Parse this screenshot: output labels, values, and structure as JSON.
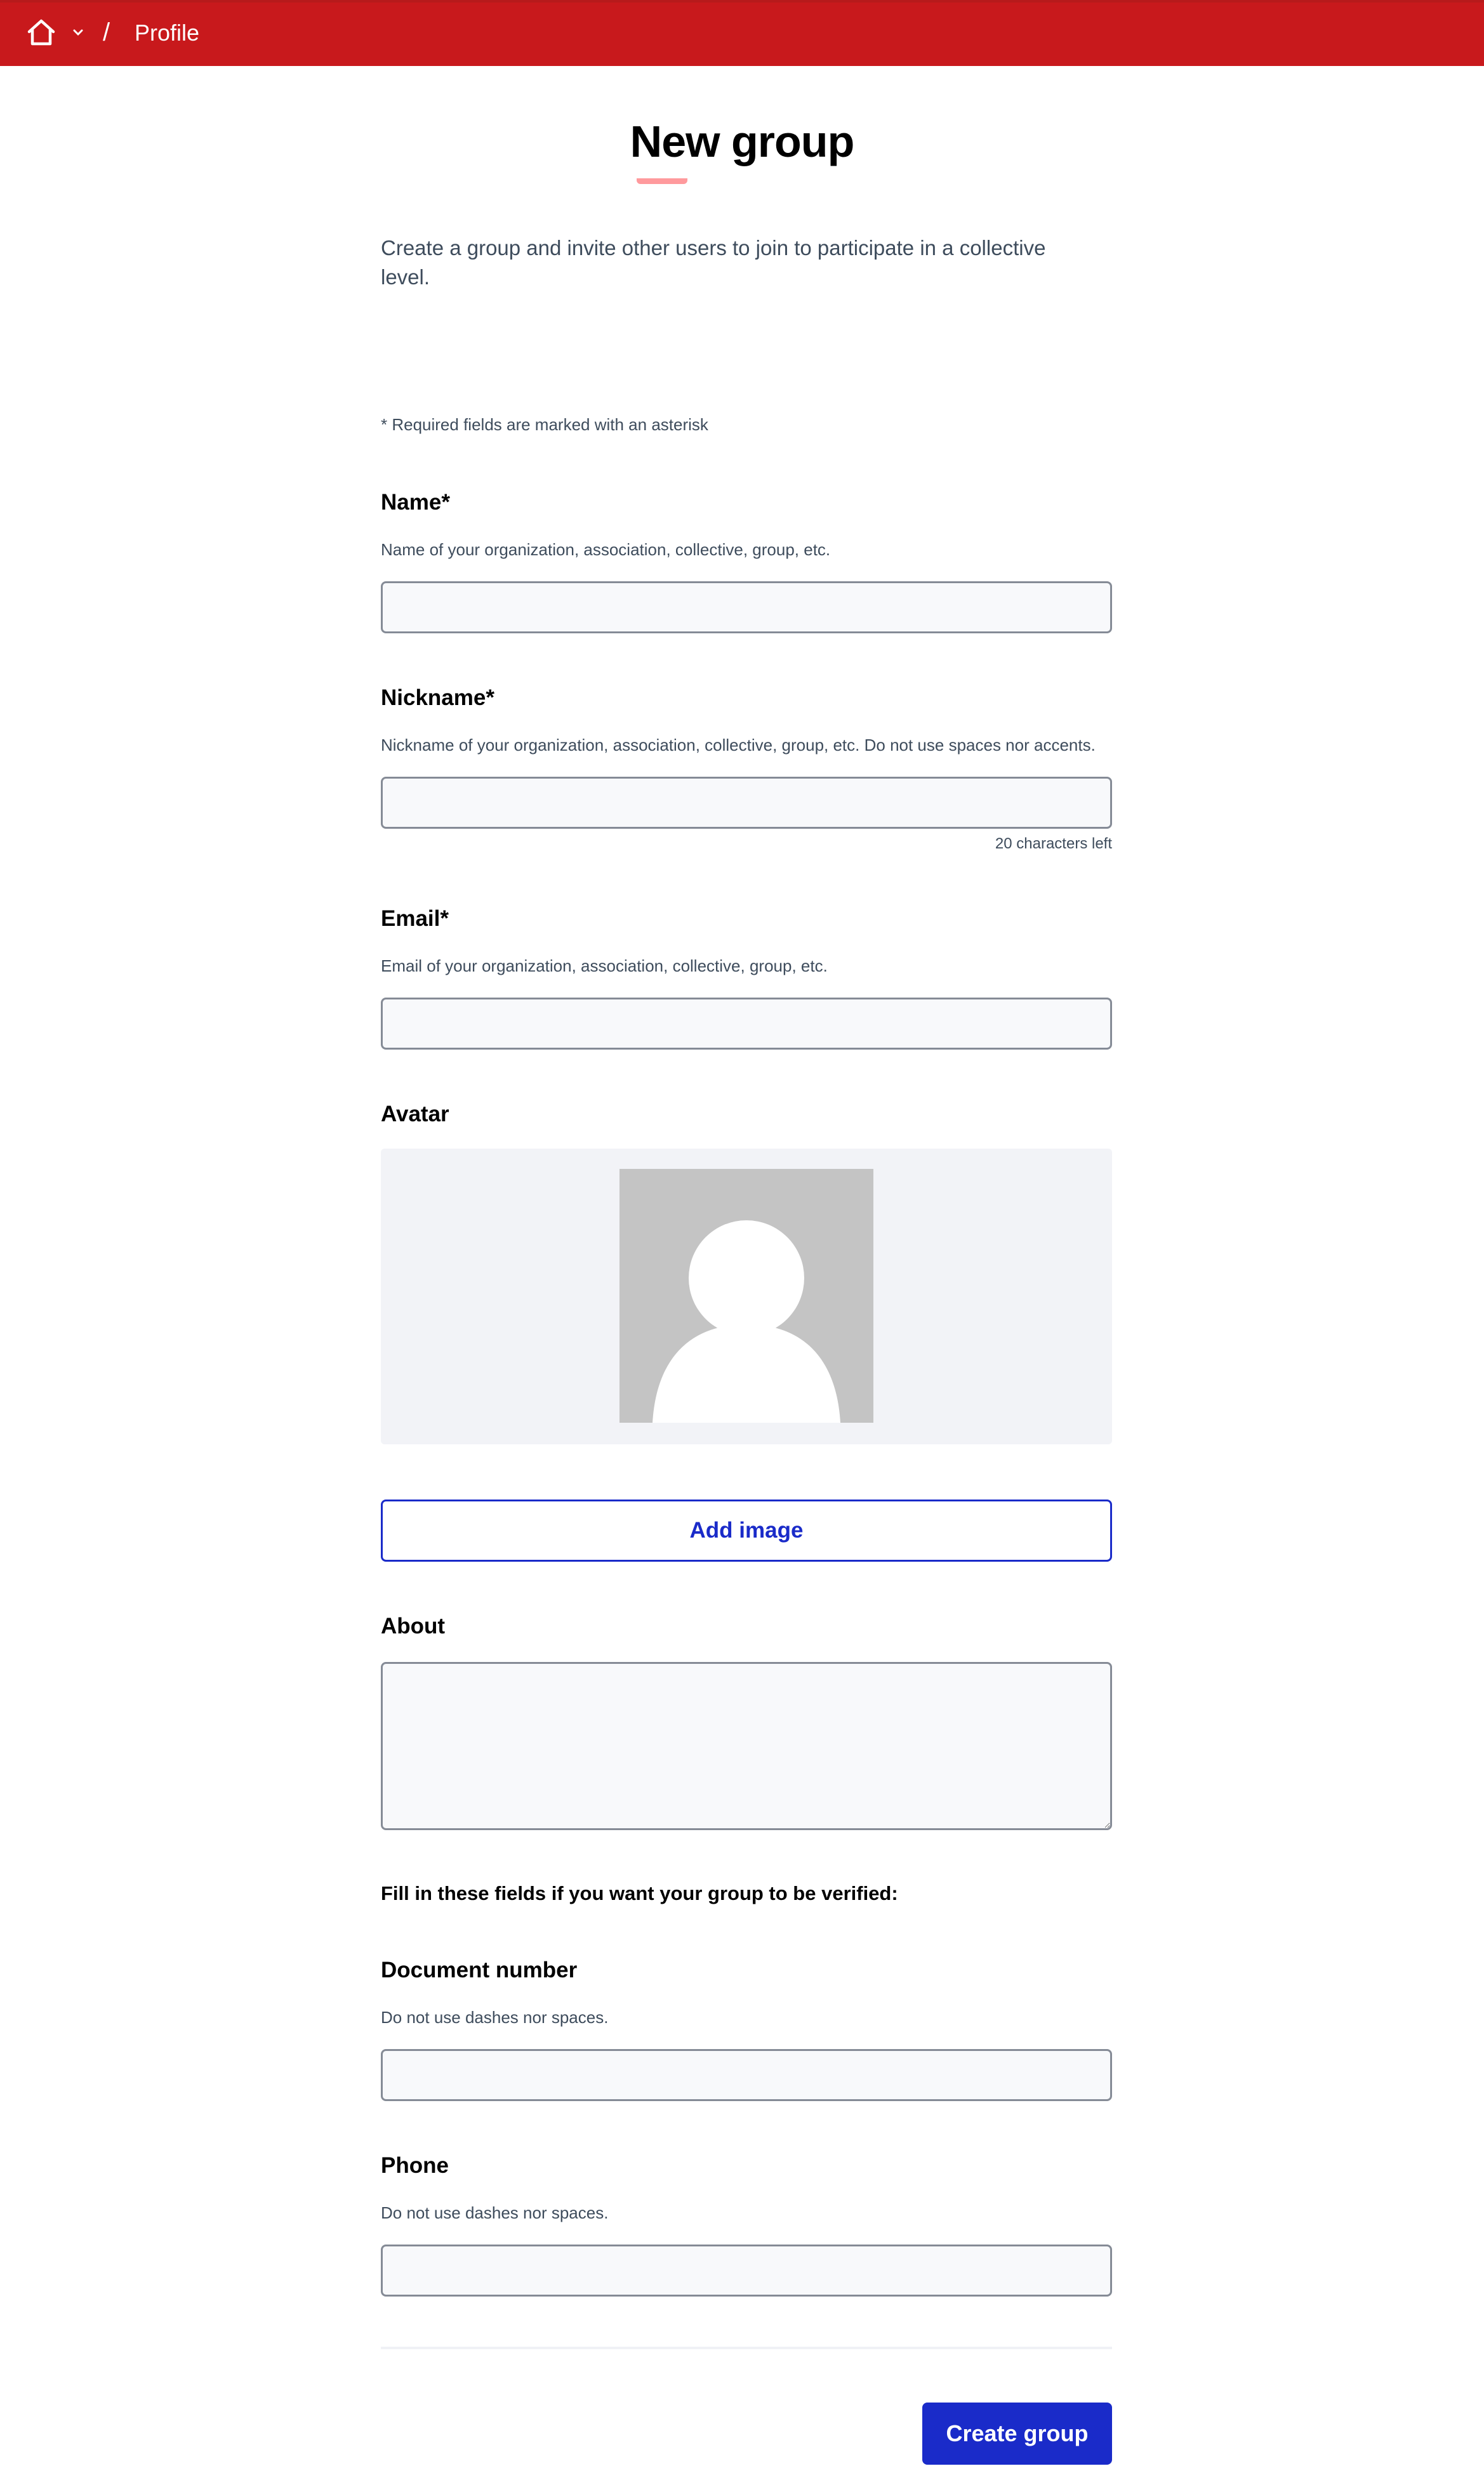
{
  "header": {
    "home_icon": "home-icon",
    "dropdown_icon": "chevron-down-icon",
    "separator": "/",
    "breadcrumb_current": "Profile",
    "background_color": "#c8191c"
  },
  "page": {
    "title": "New group",
    "intro": "Create a group and invite other users to join to participate in a collective level.",
    "required_note": "* Required fields are marked with an asterisk"
  },
  "form": {
    "name": {
      "label": "Name*",
      "help": "Name of your organization, association, collective, group, etc.",
      "value": ""
    },
    "nickname": {
      "label": "Nickname*",
      "help": "Nickname of your organization, association, collective, group, etc. Do not use spaces nor accents.",
      "value": "",
      "char_count": "20 characters left"
    },
    "email": {
      "label": "Email*",
      "help": "Email of your organization, association, collective, group, etc.",
      "value": ""
    },
    "avatar": {
      "label": "Avatar",
      "placeholder_icon": "user-silhouette-icon",
      "add_image_label": "Add image"
    },
    "about": {
      "label": "About",
      "value": ""
    },
    "verification_note": "Fill in these fields if you want your group to be verified:",
    "document_number": {
      "label": "Document number",
      "help": "Do not use dashes nor spaces.",
      "value": ""
    },
    "phone": {
      "label": "Phone",
      "help": "Do not use dashes nor spaces.",
      "value": ""
    },
    "submit_label": "Create group"
  },
  "colors": {
    "primary": "#1a2bc9",
    "accent_underline": "#ff9a9d",
    "input_border": "#858b96",
    "input_bg": "#f8f9fb"
  }
}
